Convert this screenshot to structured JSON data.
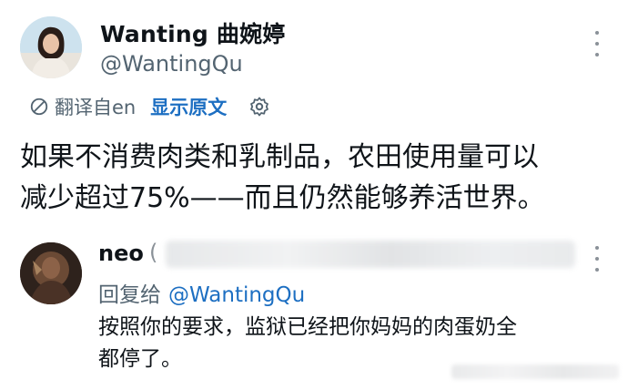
{
  "post": {
    "display_name": "Wanting 曲婉婷",
    "handle": "@WantingQu",
    "translated_from": "翻译自en",
    "show_original": "显示原文",
    "text_lines": [
      "如果不消费肉类和乳制品，农田使用量可以",
      "减少超过75%——而且仍然能够养活世界。"
    ]
  },
  "reply": {
    "display_name": "neo",
    "handle_prefix": "(",
    "replying_to_label": "回复给",
    "replying_to_handle": "@WantingQu",
    "text_lines": [
      "按照你的要求，监狱已经把你妈妈的肉蛋奶全",
      "都停了。"
    ]
  },
  "icons": {
    "translate": "translate-icon",
    "settings": "gear-icon",
    "more": "more-options-icon"
  },
  "colors": {
    "link": "#1d6fc2",
    "secondary_text": "#536471",
    "primary_text": "#0f1419"
  }
}
